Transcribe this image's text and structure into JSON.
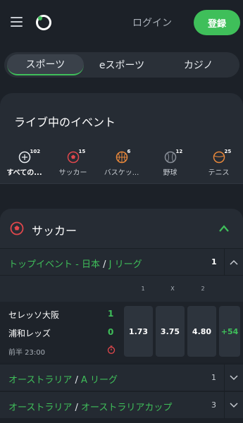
{
  "header": {
    "login_label": "ログイン",
    "register_label": "登録"
  },
  "tabs": [
    {
      "label": "スポーツ",
      "active": true
    },
    {
      "label": "eスポーツ",
      "active": false
    },
    {
      "label": "カジノ",
      "active": false
    }
  ],
  "live": {
    "title": "ライブ中のイベント",
    "sports": [
      {
        "label": "すべての...",
        "count": "102",
        "icon": "all-sports-icon"
      },
      {
        "label": "サッカー",
        "count": "15",
        "icon": "soccer-ball-icon"
      },
      {
        "label": "バスケッ...",
        "count": "6",
        "icon": "basketball-icon"
      },
      {
        "label": "野球",
        "count": "12",
        "icon": "baseball-icon"
      },
      {
        "label": "テニス",
        "count": "25",
        "icon": "tennis-ball-icon"
      }
    ]
  },
  "soccer": {
    "title": "サッカー",
    "leagues": [
      {
        "region": "トップイベント - 日本",
        "name": "J リーグ",
        "count": "1",
        "expanded": true
      },
      {
        "region": "オーストラリア",
        "name": "A リーグ",
        "count": "1",
        "expanded": false
      },
      {
        "region": "オーストラリア",
        "name": "オーストラリアカップ",
        "count": "3",
        "expanded": false
      }
    ],
    "odds_headers": [
      "1",
      "X",
      "2"
    ],
    "match": {
      "home": "セレッソ大阪",
      "away": "浦和レッズ",
      "home_score": "1",
      "away_score": "0",
      "time": "前半 23:00",
      "odds": [
        "1.73",
        "3.75",
        "4.80"
      ],
      "more_markets": "+54"
    }
  },
  "colors": {
    "accent": "#3fbf5a",
    "background": "#1c2128",
    "panel": "#262c34",
    "soccer_icon": "#e0474c"
  }
}
